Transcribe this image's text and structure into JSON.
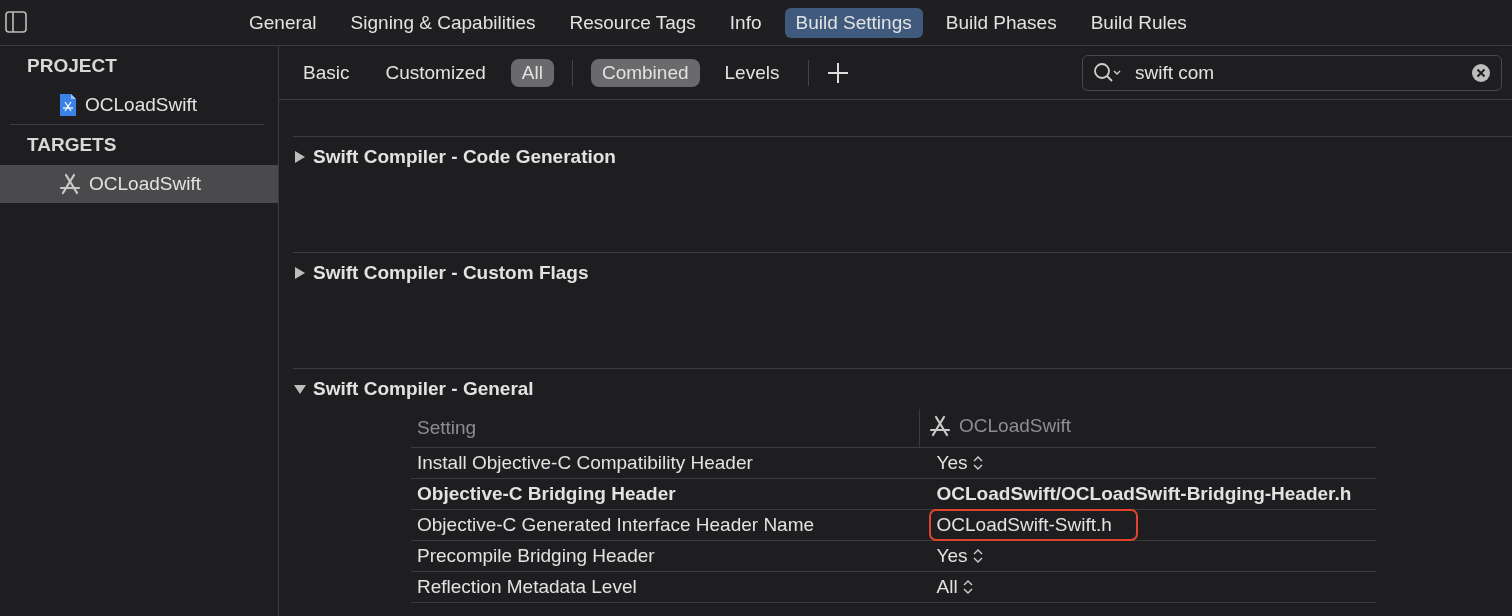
{
  "toolbar": {
    "tabs": [
      {
        "label": "General",
        "selected": false
      },
      {
        "label": "Signing & Capabilities",
        "selected": false
      },
      {
        "label": "Resource Tags",
        "selected": false
      },
      {
        "label": "Info",
        "selected": false
      },
      {
        "label": "Build Settings",
        "selected": true
      },
      {
        "label": "Build Phases",
        "selected": false
      },
      {
        "label": "Build Rules",
        "selected": false
      }
    ]
  },
  "sidebar": {
    "sections": [
      {
        "title": "PROJECT",
        "items": [
          {
            "label": "OCLoadSwift",
            "kind": "project",
            "selected": false
          }
        ]
      },
      {
        "title": "TARGETS",
        "items": [
          {
            "label": "OCLoadSwift",
            "kind": "target",
            "selected": true
          }
        ]
      }
    ]
  },
  "filter_bar": {
    "scope": [
      {
        "label": "Basic",
        "selected": false
      },
      {
        "label": "Customized",
        "selected": false
      },
      {
        "label": "All",
        "selected": true
      }
    ],
    "view": [
      {
        "label": "Combined",
        "selected": true
      },
      {
        "label": "Levels",
        "selected": false
      }
    ],
    "search": {
      "value": "swift com"
    }
  },
  "sections": [
    {
      "title": "Swift Compiler - Code Generation",
      "expanded": false
    },
    {
      "title": "Swift Compiler - Custom Flags",
      "expanded": false
    },
    {
      "title": "Swift Compiler - General",
      "expanded": true,
      "table": {
        "columns": [
          "Setting",
          "OCLoadSwift"
        ],
        "rows": [
          {
            "setting": "Install Objective-C Compatibility Header",
            "value": "Yes",
            "kind": "popup",
            "customized": false,
            "highlighted": false
          },
          {
            "setting": "Objective-C Bridging Header",
            "value": "OCLoadSwift/OCLoadSwift-Bridging-Header.h",
            "kind": "text",
            "customized": true,
            "highlighted": false
          },
          {
            "setting": "Objective-C Generated Interface Header Name",
            "value": "OCLoadSwift-Swift.h",
            "kind": "text",
            "customized": false,
            "highlighted": true
          },
          {
            "setting": "Precompile Bridging Header",
            "value": "Yes",
            "kind": "popup",
            "customized": false,
            "highlighted": false
          },
          {
            "setting": "Reflection Metadata Level",
            "value": "All",
            "kind": "popup",
            "customized": false,
            "highlighted": false
          }
        ]
      }
    }
  ]
}
